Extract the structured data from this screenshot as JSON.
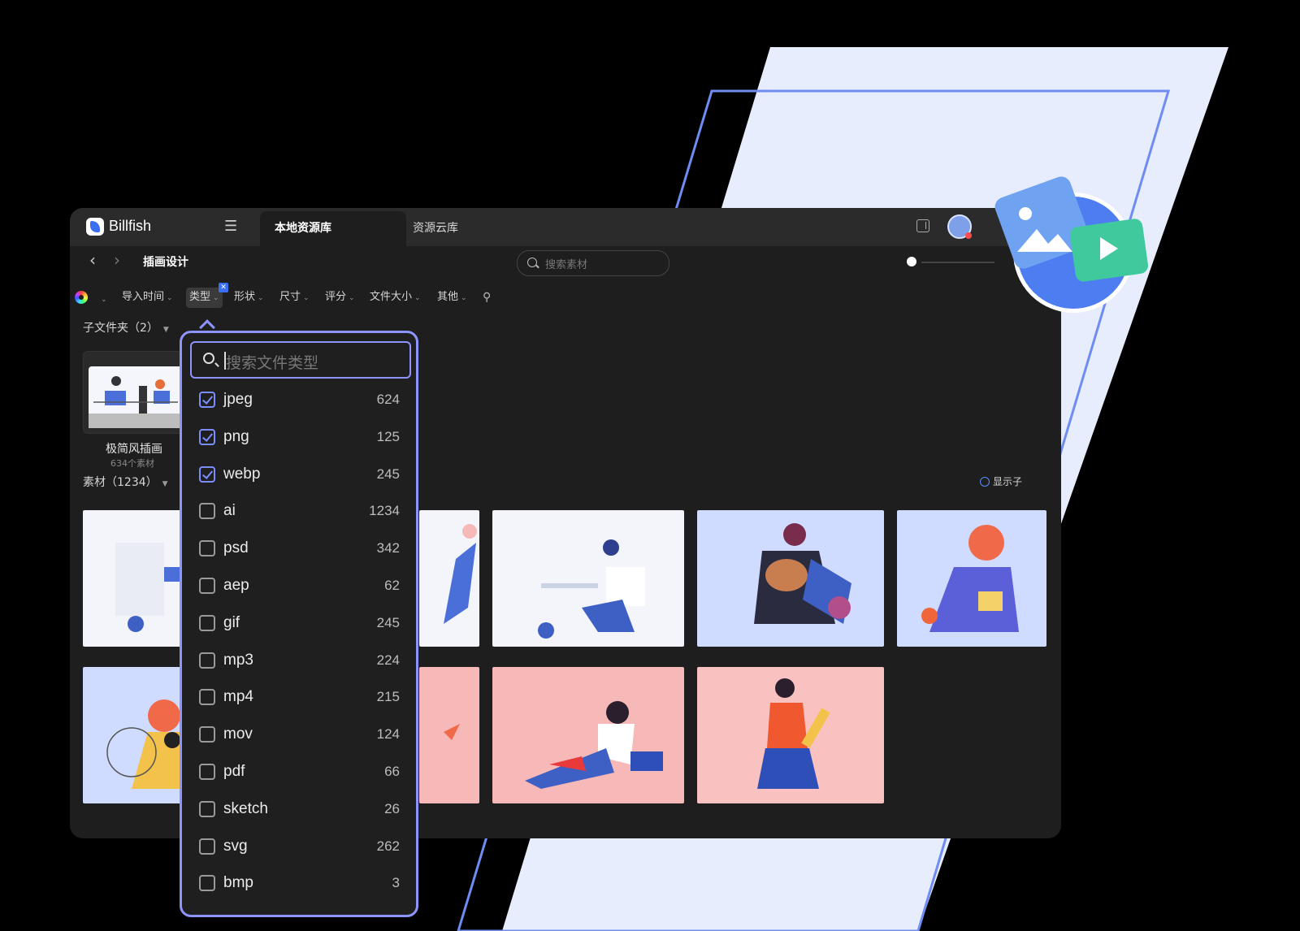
{
  "app": {
    "name": "Billfish"
  },
  "tabs": [
    {
      "label": "本地资源库"
    },
    {
      "label": "资源云库"
    }
  ],
  "breadcrumb": {
    "current": "插画设计"
  },
  "search": {
    "placeholder": "搜索素材"
  },
  "filters": {
    "items": [
      {
        "label": "导入时间"
      },
      {
        "label": "类型"
      },
      {
        "label": "形状"
      },
      {
        "label": "尺寸"
      },
      {
        "label": "评分"
      },
      {
        "label": "文件大小"
      },
      {
        "label": "其他"
      }
    ],
    "active_badge": "✕"
  },
  "subfolders": {
    "label": "子文件夹（2）",
    "folder": {
      "name": "极简风插画",
      "count": "634个素材"
    }
  },
  "assets": {
    "label": "素材（1234）",
    "show_sub": "显示子"
  },
  "dropdown": {
    "placeholder": "搜索文件类型",
    "types": [
      {
        "name": "jpeg",
        "count": "624",
        "checked": true
      },
      {
        "name": "png",
        "count": "125",
        "checked": true
      },
      {
        "name": "webp",
        "count": "245",
        "checked": true
      },
      {
        "name": "ai",
        "count": "1234",
        "checked": false
      },
      {
        "name": "psd",
        "count": "342",
        "checked": false
      },
      {
        "name": "aep",
        "count": "62",
        "checked": false
      },
      {
        "name": "gif",
        "count": "245",
        "checked": false
      },
      {
        "name": "mp3",
        "count": "224",
        "checked": false
      },
      {
        "name": "mp4",
        "count": "215",
        "checked": false
      },
      {
        "name": "mov",
        "count": "124",
        "checked": false
      },
      {
        "name": "pdf",
        "count": "66",
        "checked": false
      },
      {
        "name": "sketch",
        "count": "26",
        "checked": false
      },
      {
        "name": "svg",
        "count": "262",
        "checked": false
      },
      {
        "name": "bmp",
        "count": "3",
        "checked": false
      }
    ]
  },
  "colors": {
    "accent": "#8e94ff",
    "backdrop_panel": "#e8edfd",
    "frame_line": "#6f8cf2",
    "window_bg": "#1e1e1e"
  }
}
